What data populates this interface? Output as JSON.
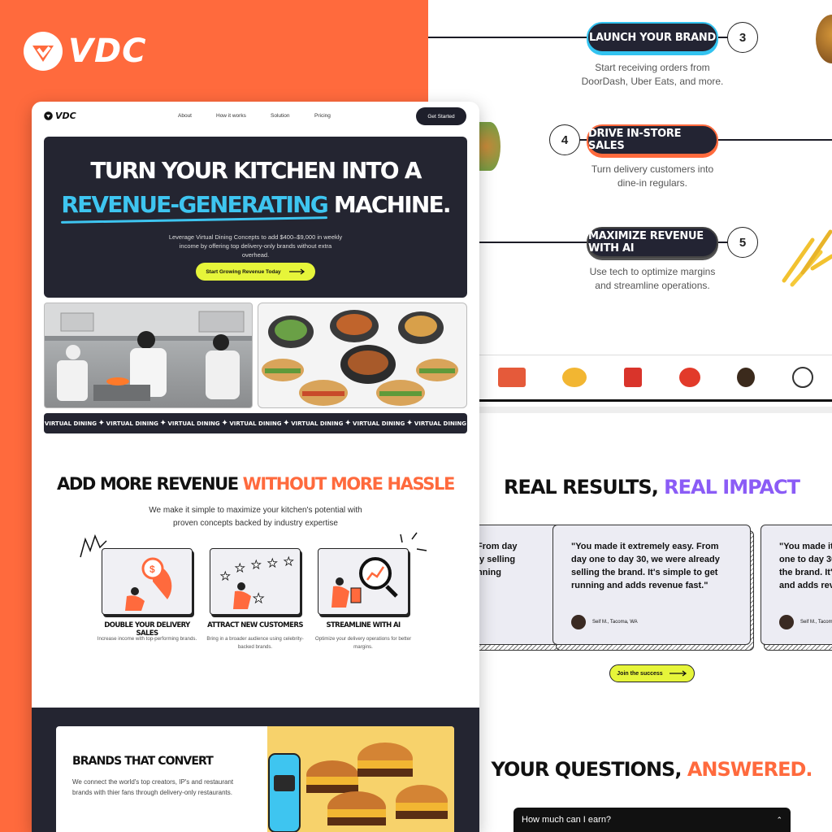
{
  "brand": {
    "name": "VDC"
  },
  "steps": [
    {
      "number": "3",
      "label": "LAUNCH YOUR BRAND",
      "desc_line1": "Start receiving orders from",
      "desc_line2": "DoorDash, Uber Eats, and more."
    },
    {
      "number": "4",
      "label": "DRIVE IN-STORE SALES",
      "desc_line1": "Turn delivery customers into",
      "desc_line2": "dine-in regulars."
    },
    {
      "number": "5",
      "label": "MAXIMIZE REVENUE WITH AI",
      "desc_line1": "Use tech to optimize margins",
      "desc_line2": "and streamline operations."
    }
  ],
  "results": {
    "title_main": "REAL RESULTS,",
    "title_accent": "REAL IMPACT",
    "left_partial": [
      "From day",
      "ly selling",
      "nning"
    ],
    "center_quote": "\"You made it extremely easy. From day one to day 30, we were already selling the brand. It's simple to get running and adds revenue fast.\"",
    "center_author": "Seif M., Tacoma, WA",
    "right_partial": [
      "\"You made it",
      "one to day 30",
      "the brand. It's",
      "and adds reve"
    ],
    "right_author": "Seif M., Tacom",
    "cta": "Join the success"
  },
  "faq": {
    "title_main": "YOUR QUESTIONS,",
    "title_accent": "ANSWERED.",
    "first_question": "How much can I earn?"
  },
  "card": {
    "logo": "VDC",
    "nav": [
      "About",
      "How it works",
      "Solution",
      "Pricing"
    ],
    "nav_cta": "Get Started",
    "hero_line1": "TURN YOUR KITCHEN INTO A",
    "hero_line2_hl": "REVENUE-GENERATING",
    "hero_line2_rest": " MACHINE.",
    "hero_sub": "Leverage Virtual Dining Concepts to add $400–$9,000 in weekly income by offering top delivery-only brands without extra overhead.",
    "hero_cta": "Start Growing Revenue Today",
    "ticker": [
      "VIRTUAL DINING",
      "VIRTUAL DINING",
      "VIRTUAL DINING",
      "VIRTUAL DINING",
      "VIRTUAL DINING",
      "VIRTUAL DINING",
      "VIRTUAL DINING"
    ],
    "section_title_main": "ADD MORE REVENUE",
    "section_title_accent": "WITHOUT MORE HASSLE",
    "section_sub": "We make it simple to maximize your kitchen's potential with proven concepts backed by industry expertise",
    "features": [
      {
        "title": "DOUBLE YOUR DELIVERY SALES",
        "desc": "Increase income with top-performing brands."
      },
      {
        "title": "ATTRACT NEW CUSTOMERS",
        "desc": "Bring in a broader audience using celebrity-backed brands."
      },
      {
        "title": "STREAMLINE WITH AI",
        "desc": "Optimize your delivery operations for better margins."
      }
    ],
    "brands_title": "BRANDS THAT CONVERT",
    "brands_desc": "We connect the world's top creators, IP's and restaurant brands with thier fans through delivery-only restaurants."
  },
  "colors": {
    "orange": "#ff6a3d",
    "blue": "#3ec5f0",
    "lime": "#e6f53a",
    "purple": "#8b5cf6",
    "dark": "#242531"
  }
}
